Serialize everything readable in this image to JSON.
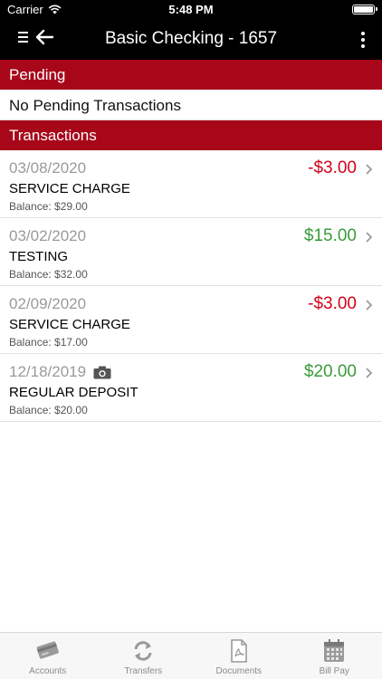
{
  "status_bar": {
    "carrier": "Carrier",
    "time": "5:48 PM"
  },
  "nav": {
    "title": "Basic Checking - 1657",
    "icons": [
      "menu-icon",
      "back-arrow-icon",
      "more-vertical-icon"
    ]
  },
  "pending": {
    "header": "Pending",
    "empty_text": "No Pending Transactions"
  },
  "transactions": {
    "header": "Transactions",
    "items": [
      {
        "date": "03/08/2020",
        "amount": "-$3.00",
        "sign": "neg",
        "description": "SERVICE CHARGE",
        "balance": "Balance: $29.00",
        "has_camera": false
      },
      {
        "date": "03/02/2020",
        "amount": "$15.00",
        "sign": "pos",
        "description": "TESTING",
        "balance": "Balance: $32.00",
        "has_camera": false
      },
      {
        "date": "02/09/2020",
        "amount": "-$3.00",
        "sign": "neg",
        "description": "SERVICE CHARGE",
        "balance": "Balance: $17.00",
        "has_camera": false
      },
      {
        "date": "12/18/2019",
        "amount": "$20.00",
        "sign": "pos",
        "description": "REGULAR DEPOSIT",
        "balance": "Balance: $20.00",
        "has_camera": true
      }
    ]
  },
  "tabbar": {
    "tabs": [
      {
        "label": "Accounts",
        "icon": "accounts-card-icon"
      },
      {
        "label": "Transfers",
        "icon": "transfer-arrows-icon"
      },
      {
        "label": "Documents",
        "icon": "pdf-document-icon"
      },
      {
        "label": "Bill Pay",
        "icon": "calendar-icon"
      }
    ]
  },
  "colors": {
    "section_header": "#a8071a",
    "negative_amount": "#d0021b",
    "positive_amount": "#3a9a3a"
  }
}
